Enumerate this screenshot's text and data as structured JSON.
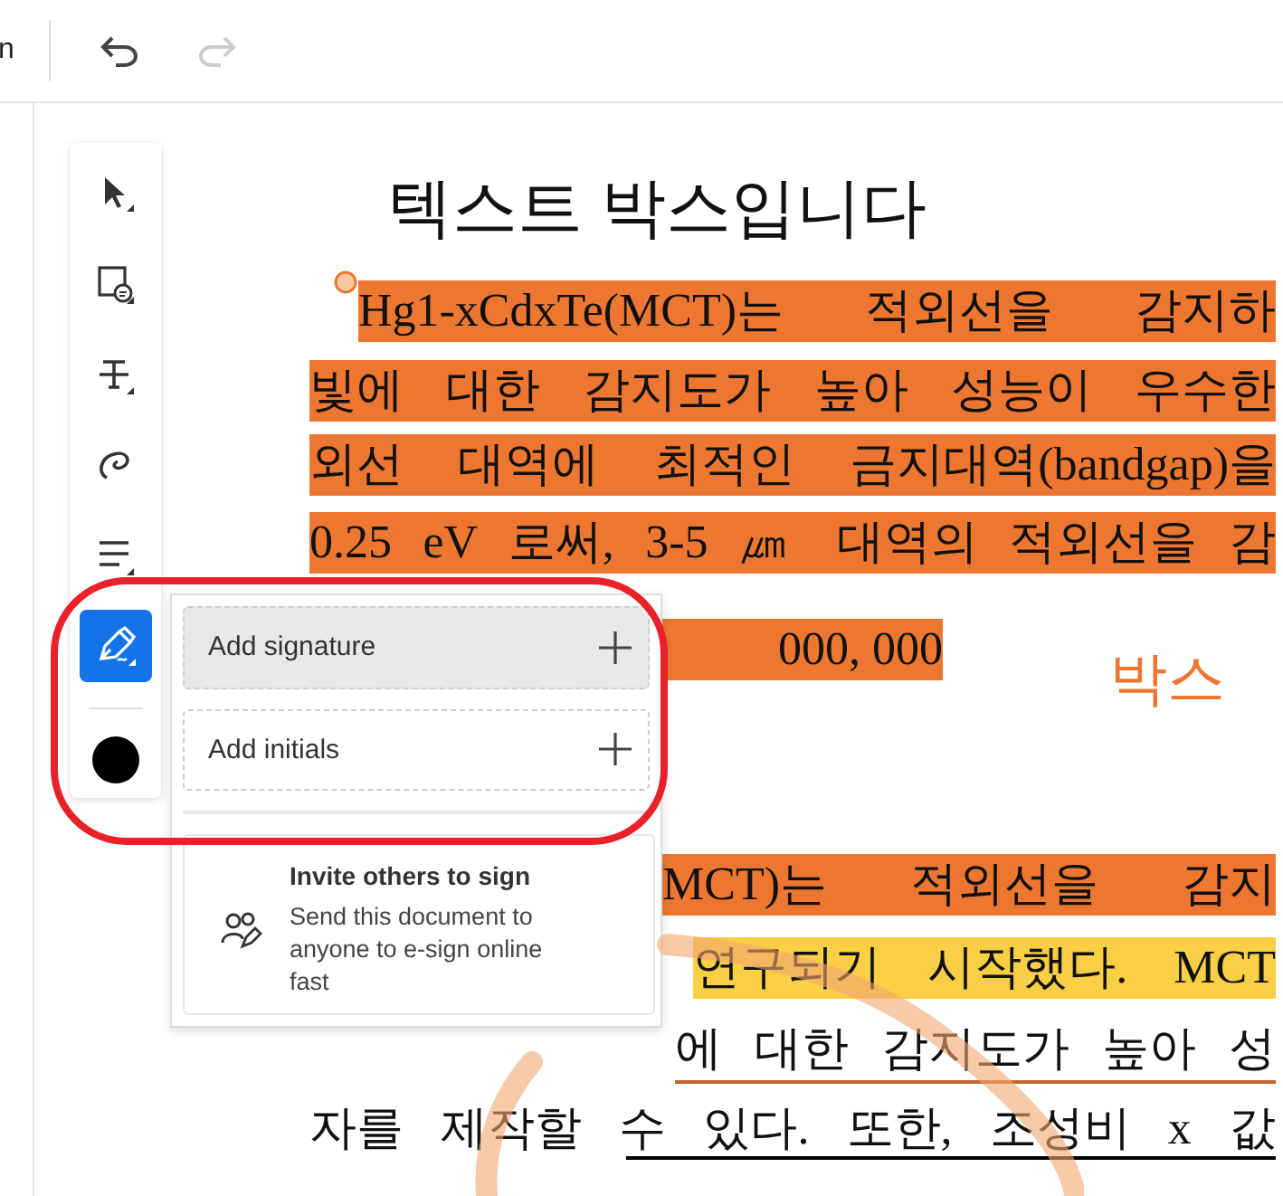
{
  "toolbar": {
    "menu_label": "n",
    "undo": {
      "disabled": false
    },
    "redo": {
      "disabled": true
    }
  },
  "tools": [
    {
      "kind": "select",
      "selected": false
    },
    {
      "kind": "textbox",
      "selected": false
    },
    {
      "kind": "strikethrough",
      "selected": false
    },
    {
      "kind": "freehand",
      "selected": false
    },
    {
      "kind": "lines",
      "selected": false
    },
    {
      "kind": "sign",
      "selected": true
    }
  ],
  "document": {
    "title": "텍스트 박스입니다",
    "side_heading": "박스",
    "lines": [
      {
        "text": "Hg1-xCdxTe(MCT)는 적외선을 감지하",
        "kind": "orange"
      },
      {
        "text": "빛에 대한 감지도가 높아 성능이 우수한",
        "kind": "orange"
      },
      {
        "text": "외선 대역에 최적인 금지대역(bandgap)을",
        "kind": "orange"
      },
      {
        "text": "0.25 eV 로써, 3-5 ㎛ 대역의 적외선을 감",
        "kind": "orange"
      },
      {
        "text": "000, 000",
        "kind": "orange"
      },
      {
        "text": "MCT)는 적외선을 감지",
        "kind": "orange"
      },
      {
        "text": "연구되기 시작했다. MCT",
        "kind": "yellow"
      },
      {
        "text": "에 대한 감지도가 높아 성",
        "kind": "underline-orange"
      },
      {
        "text": "자를 제작할 수 있다. 또한, 조성비 x 값",
        "kind": "underline-black"
      }
    ]
  },
  "sign_menu": {
    "items": [
      {
        "label": "Add signature",
        "selected": true
      },
      {
        "label": "Add initials",
        "selected": false
      }
    ],
    "invite": {
      "title": "Invite others to sign",
      "description": "Send this document to anyone to e-sign online fast"
    }
  }
}
